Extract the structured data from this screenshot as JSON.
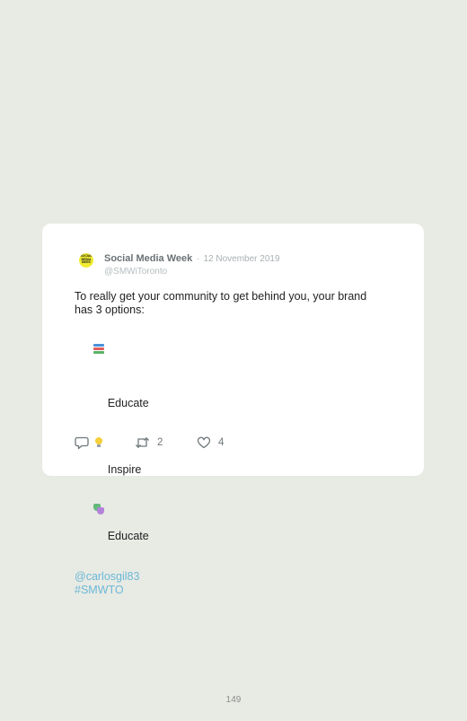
{
  "tweet": {
    "avatar_text": "SOCIAL MEDIA WEEK",
    "author_name": "Social Media Week",
    "separator": "·",
    "date": "12 November 2019",
    "handle": "@SMWiToronto",
    "text_line1": "To really get your community to get behind you, your brand",
    "text_line2": "has 3 options:",
    "options": [
      {
        "icon": "books-icon",
        "label": "Educate"
      },
      {
        "icon": "lightbulb-icon",
        "label": "Inspire"
      },
      {
        "icon": "theater-masks-icon",
        "label": "Educate"
      }
    ],
    "mention": "@carlosgil83",
    "hashtag": "#SMWTO",
    "actions": {
      "reply_count": "",
      "retweet_count": "2",
      "like_count": "4"
    }
  },
  "page_number": "149",
  "colors": {
    "background": "#e8eae4",
    "card": "#ffffff",
    "link": "#6cb9d6",
    "avatar": "#f1ec2f"
  }
}
